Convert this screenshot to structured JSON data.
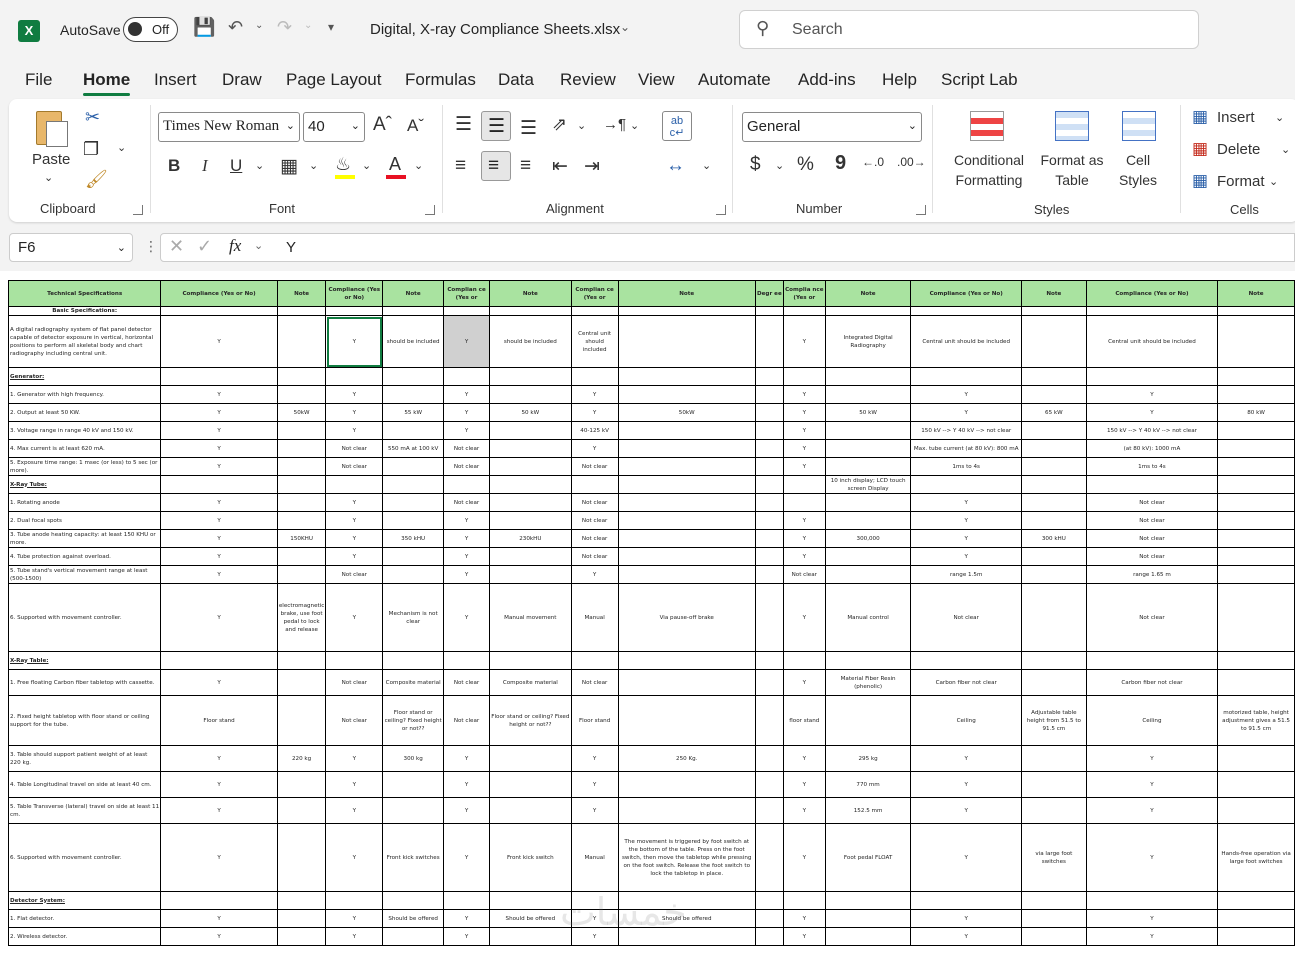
{
  "titlebar": {
    "app_logo": "X",
    "autosave_label": "AutoSave",
    "toggle_label": "Off",
    "filename": "Digital, X-ray Compliance Sheets.xlsx",
    "search_placeholder": "Search"
  },
  "menu": [
    "File",
    "Home",
    "Insert",
    "Draw",
    "Page Layout",
    "Formulas",
    "Data",
    "Review",
    "View",
    "Automate",
    "Add-ins",
    "Help",
    "Script Lab"
  ],
  "menu_active": "Home",
  "ribbon": {
    "clipboard": {
      "label": "Clipboard",
      "paste": "Paste"
    },
    "font": {
      "label": "Font",
      "family": "Times New Roman",
      "size": "40",
      "bold": "B",
      "italic": "I",
      "underline": "U"
    },
    "alignment": {
      "label": "Alignment"
    },
    "number": {
      "label": "Number",
      "format": "General",
      "currency": "$",
      "percent": "%",
      "comma": "9"
    },
    "styles": {
      "label": "Styles",
      "conditional": "Conditional Formatting",
      "format_table": "Format as Table",
      "cell_styles": "Cell Styles"
    },
    "cells": {
      "label": "Cells",
      "insert": "Insert",
      "delete": "Delete",
      "format": "Format"
    }
  },
  "formula_bar": {
    "name_box": "F6",
    "value": "Y",
    "fx": "fx"
  },
  "sheet": {
    "headers": [
      "Technical Specifications",
      "Compliance (Yes or No)",
      "Note",
      "Compliance (Yes or No)",
      "Note",
      "Complian ce (Yes or",
      "Note",
      "Complian ce (Yes or",
      "Note",
      "Degr ee",
      "Complia nce (Yes or",
      "Note",
      "Compliance (Yes or No)",
      "Note",
      "Compliance (Yes or No)",
      "Note"
    ],
    "rows": [
      {
        "k": "sub",
        "c": [
          "Basic Specifications:",
          "",
          "",
          "",
          "",
          "",
          "",
          "",
          "",
          "",
          "",
          "",
          "",
          "",
          "",
          ""
        ]
      },
      {
        "k": "tall",
        "c": [
          "A digital radiography system of flat panel detector capable of detector exposure in vertical, horizontal positions to perform all skeletal body and chart radiography including central unit.",
          "Y",
          "",
          "Y",
          "should be included",
          "Y",
          "should be included",
          "Central unit should included",
          "",
          "",
          "Y",
          "Integrated Digital Radiography",
          "Central unit should be included",
          "",
          "Central unit should be included",
          ""
        ]
      },
      {
        "k": "sec",
        "c": [
          "Generator:",
          "",
          "",
          "",
          "",
          "",
          "",
          "",
          "",
          "",
          "",
          "",
          "",
          "",
          "",
          ""
        ]
      },
      {
        "k": "n",
        "c": [
          "1.  Generator with high frequency.",
          "Y",
          "",
          "Y",
          "",
          "Y",
          "",
          "Y",
          "",
          "",
          "Y",
          "",
          "Y",
          "",
          "Y",
          ""
        ]
      },
      {
        "k": "n",
        "c": [
          "2.  Output at least 50 KW.",
          "Y",
          "50kW",
          "Y",
          "55 kW",
          "Y",
          "50 kW",
          "Y",
          "50kW",
          "",
          "Y",
          "50 kW",
          "Y",
          "65 kW",
          "Y",
          "80 kW"
        ]
      },
      {
        "k": "n",
        "c": [
          "3.  Voltage range in range 40 kV and 150 kV.",
          "Y",
          "",
          "Y",
          "",
          "Y",
          "",
          "40-125 kV",
          "",
          "",
          "Y",
          "",
          "150 kV --> Y 40 kV --> not clear",
          "",
          "150 kV --> Y 40 kV --> not clear",
          ""
        ]
      },
      {
        "k": "n",
        "c": [
          "4.  Max current is at least 620 mA.",
          "Y",
          "",
          "Not clear",
          "550 mA at 100 kV",
          "Not clear",
          "",
          "Y",
          "",
          "",
          "Y",
          "",
          "Max. tube current (at 80 kV): 800 mA",
          "",
          "(at 80 kV): 1000 mA",
          ""
        ]
      },
      {
        "k": "n",
        "c": [
          "5.  Exposure time range: 1 msec (or less) to 5 sec (or more).",
          "Y",
          "",
          "Not clear",
          "",
          "Not clear",
          "",
          "Not clear",
          "",
          "",
          "Y",
          "",
          "1ms to 4s",
          "",
          "1ms to 4s",
          ""
        ]
      },
      {
        "k": "sec",
        "c": [
          "X-Ray Tube:",
          "",
          "",
          "",
          "",
          "",
          "",
          "",
          "",
          "",
          "",
          "10 inch display; LCD touch screen Display",
          "",
          "",
          "",
          ""
        ]
      },
      {
        "k": "n",
        "c": [
          "1.  Rotating anode",
          "Y",
          "",
          "Y",
          "",
          "Not clear",
          "",
          "Not clear",
          "",
          "",
          "",
          "",
          "Y",
          "",
          "Not clear",
          ""
        ]
      },
      {
        "k": "n",
        "c": [
          "2.  Dual focal spots",
          "Y",
          "",
          "Y",
          "",
          "Y",
          "",
          "Not clear",
          "",
          "",
          "Y",
          "",
          "Y",
          "",
          "Not clear",
          ""
        ]
      },
      {
        "k": "n",
        "c": [
          "3.  Tube anode heating capacity: at least 150 KHU or more.",
          "Y",
          "150KHU",
          "Y",
          "350 kHU",
          "Y",
          "230kHU",
          "Not clear",
          "",
          "",
          "Y",
          "300,000",
          "Y",
          "300 kHU",
          "Not clear",
          ""
        ]
      },
      {
        "k": "n",
        "c": [
          "4.  Tube protection against overload.",
          "Y",
          "",
          "Y",
          "",
          "Y",
          "",
          "Not clear",
          "",
          "",
          "Y",
          "",
          "Y",
          "",
          "Not clear",
          ""
        ]
      },
      {
        "k": "n",
        "c": [
          "5.  Tube stand's vertical movement range at least (500-1500)",
          "Y",
          "",
          "Not clear",
          "",
          "Y",
          "",
          "Y",
          "",
          "",
          "Not clear",
          "",
          "range 1.5m",
          "",
          "range 1.65 m",
          ""
        ]
      },
      {
        "k": "big",
        "c": [
          "6.  Supported with movement controller.",
          "Y",
          "electromagnetic brake, use foot pedal to lock and release",
          "Y",
          "Mechanism is not clear",
          "Y",
          "Manual movement",
          "Manual",
          "Via pause-off brake",
          "",
          "Y",
          "Manual control",
          "Not clear",
          "",
          "Not clear",
          ""
        ]
      },
      {
        "k": "sec",
        "c": [
          "X-Ray Table:",
          "",
          "",
          "",
          "",
          "",
          "",
          "",
          "",
          "",
          "",
          "",
          "",
          "",
          "",
          ""
        ]
      },
      {
        "k": "mid",
        "c": [
          "1.  Free floating Carbon fiber tabletop with cassette.",
          "Y",
          "",
          "Not clear",
          "Composite material",
          "Not clear",
          "Composite material",
          "Not clear",
          "",
          "",
          "Y",
          "Material Fiber Resin (phenolic)",
          "Carbon fiber not clear",
          "",
          "Carbon fiber not clear",
          ""
        ]
      },
      {
        "k": "big2",
        "c": [
          "2.  Fixed height tabletop with floor stand or ceiling support for the tube.",
          "Floor stand",
          "",
          "Not clear",
          "Floor stand or ceiling? Fixed height or not??",
          "Not clear",
          "Floor stand or ceiling? Fixed height or not??",
          "Floor stand",
          "",
          "",
          "floor stand",
          "",
          "Ceiling",
          "Adjustable table height from 51.5 to 91.5 cm",
          "Ceiling",
          "motorized table, height adjustment gives a 51.5 to 91.5 cm"
        ]
      },
      {
        "k": "mid",
        "c": [
          "3.  Table should support patient weight of at least 220 kg.",
          "Y",
          "220 kg",
          "Y",
          "300 kg",
          "Y",
          "",
          "Y",
          "250 Kg.",
          "",
          "Y",
          "295 kg",
          "Y",
          "",
          "Y",
          ""
        ]
      },
      {
        "k": "mid",
        "c": [
          "4.  Table Longitudinal travel on side at least 40 cm.",
          "Y",
          "",
          "Y",
          "",
          "Y",
          "",
          "Y",
          "",
          "",
          "Y",
          "770 mm",
          "Y",
          "",
          "Y",
          ""
        ]
      },
      {
        "k": "mid",
        "c": [
          "5.  Table Transverse (lateral) travel on side at least 11 cm.",
          "Y",
          "",
          "Y",
          "",
          "Y",
          "",
          "Y",
          "",
          "",
          "Y",
          "152.5 mm",
          "Y",
          "",
          "Y",
          ""
        ]
      },
      {
        "k": "big3",
        "c": [
          "6.  Supported with movement controller.",
          "Y",
          "",
          "Y",
          "Front kick switches",
          "Y",
          "Front kick switch",
          "Manual",
          "The movement is triggered by foot switch at the bottom of the table. Press on the foot switch, then move the tabletop while pressing on the foot switch. Release the foot switch to lock the tabletop in place.",
          "",
          "Y",
          "Foot pedal FLOAT",
          "Y",
          "via large foot switches",
          "Y",
          "Hands-free operation via large foot switches"
        ]
      },
      {
        "k": "sec",
        "c": [
          "Detector System:",
          "",
          "",
          "",
          "",
          "",
          "",
          "",
          "",
          "",
          "",
          "",
          "",
          "",
          "",
          ""
        ]
      },
      {
        "k": "n",
        "c": [
          "1.  Flat detector.",
          "Y",
          "",
          "Y",
          "Should be offered",
          "Y",
          "Should be offered",
          "Y",
          "Should be offered",
          "",
          "Y",
          "",
          "Y",
          "",
          "Y",
          ""
        ]
      },
      {
        "k": "n",
        "c": [
          "2.  Wireless detector.",
          "Y",
          "",
          "Y",
          "",
          "Y",
          "",
          "Y",
          "",
          "",
          "Y",
          "",
          "Y",
          "",
          "Y",
          ""
        ]
      }
    ]
  },
  "watermark": "خمسات"
}
